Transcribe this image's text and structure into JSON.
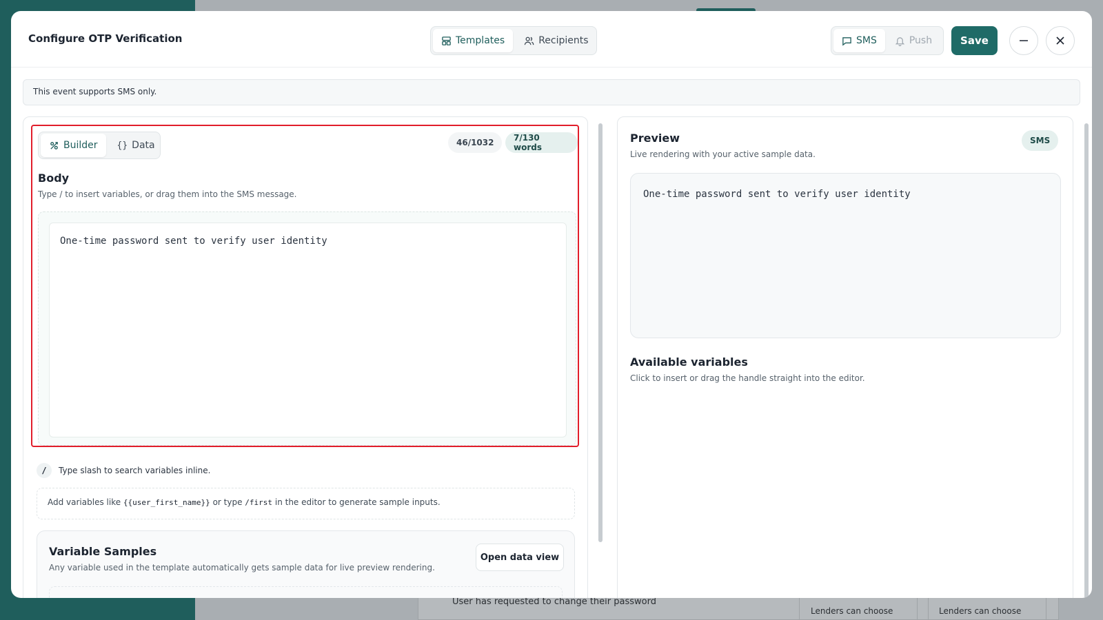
{
  "background": {
    "row_text": "User has requested to change their password",
    "col_texts": [
      "Lenders can choose",
      "Lenders can choose"
    ]
  },
  "modal": {
    "title": "Configure OTP Verification",
    "tabs": [
      {
        "label": "Templates",
        "icon": "template-icon",
        "active": true
      },
      {
        "label": "Recipients",
        "icon": "users-icon",
        "active": false
      }
    ],
    "channels": [
      {
        "label": "SMS",
        "icon": "message-icon",
        "active": true
      },
      {
        "label": "Push",
        "icon": "bell-icon",
        "active": false
      }
    ],
    "save_label": "Save",
    "notice": "This event supports SMS only."
  },
  "editor": {
    "modes": [
      {
        "label": "Builder",
        "icon": "builder-icon",
        "active": true
      },
      {
        "label": "Data",
        "icon": "braces-icon",
        "active": false
      }
    ],
    "char_count": "46/1032",
    "word_count": "7/130 words",
    "body_title": "Body",
    "body_subtitle": "Type / to insert variables, or drag them into the SMS message.",
    "body_text": "One-time password sent to verify user identity",
    "slash_badge": "/",
    "slash_hint": "Type slash to search variables inline.",
    "hint_prefix": "Add variables like ",
    "hint_code_1": "{{user_first_name}}",
    "hint_middle": " or type ",
    "hint_code_2": "/first",
    "hint_suffix": " in the editor to generate sample inputs."
  },
  "samples": {
    "title": "Variable Samples",
    "subtitle": "Any variable used in the template automatically gets sample data for live preview rendering.",
    "open_label": "Open data view"
  },
  "preview": {
    "title": "Preview",
    "subtitle": "Live rendering with your active sample data.",
    "badge": "SMS",
    "text": "One-time password sent to verify user identity",
    "variables_title": "Available variables",
    "variables_subtitle": "Click to insert or drag the handle straight into the editor."
  },
  "colors": {
    "accent": "#1f6b67",
    "highlight_border": "#e11d2a"
  }
}
